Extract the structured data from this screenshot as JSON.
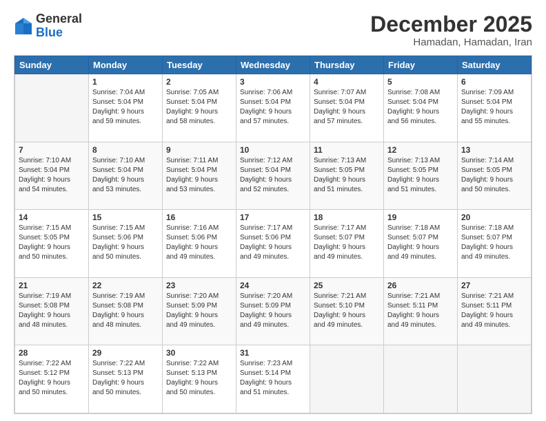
{
  "logo": {
    "general": "General",
    "blue": "Blue"
  },
  "header": {
    "month": "December 2025",
    "location": "Hamadan, Hamadan, Iran"
  },
  "weekdays": [
    "Sunday",
    "Monday",
    "Tuesday",
    "Wednesday",
    "Thursday",
    "Friday",
    "Saturday"
  ],
  "weeks": [
    [
      {
        "day": "",
        "info": ""
      },
      {
        "day": "1",
        "info": "Sunrise: 7:04 AM\nSunset: 5:04 PM\nDaylight: 9 hours\nand 59 minutes."
      },
      {
        "day": "2",
        "info": "Sunrise: 7:05 AM\nSunset: 5:04 PM\nDaylight: 9 hours\nand 58 minutes."
      },
      {
        "day": "3",
        "info": "Sunrise: 7:06 AM\nSunset: 5:04 PM\nDaylight: 9 hours\nand 57 minutes."
      },
      {
        "day": "4",
        "info": "Sunrise: 7:07 AM\nSunset: 5:04 PM\nDaylight: 9 hours\nand 57 minutes."
      },
      {
        "day": "5",
        "info": "Sunrise: 7:08 AM\nSunset: 5:04 PM\nDaylight: 9 hours\nand 56 minutes."
      },
      {
        "day": "6",
        "info": "Sunrise: 7:09 AM\nSunset: 5:04 PM\nDaylight: 9 hours\nand 55 minutes."
      }
    ],
    [
      {
        "day": "7",
        "info": "Sunrise: 7:10 AM\nSunset: 5:04 PM\nDaylight: 9 hours\nand 54 minutes."
      },
      {
        "day": "8",
        "info": "Sunrise: 7:10 AM\nSunset: 5:04 PM\nDaylight: 9 hours\nand 53 minutes."
      },
      {
        "day": "9",
        "info": "Sunrise: 7:11 AM\nSunset: 5:04 PM\nDaylight: 9 hours\nand 53 minutes."
      },
      {
        "day": "10",
        "info": "Sunrise: 7:12 AM\nSunset: 5:04 PM\nDaylight: 9 hours\nand 52 minutes."
      },
      {
        "day": "11",
        "info": "Sunrise: 7:13 AM\nSunset: 5:05 PM\nDaylight: 9 hours\nand 51 minutes."
      },
      {
        "day": "12",
        "info": "Sunrise: 7:13 AM\nSunset: 5:05 PM\nDaylight: 9 hours\nand 51 minutes."
      },
      {
        "day": "13",
        "info": "Sunrise: 7:14 AM\nSunset: 5:05 PM\nDaylight: 9 hours\nand 50 minutes."
      }
    ],
    [
      {
        "day": "14",
        "info": "Sunrise: 7:15 AM\nSunset: 5:05 PM\nDaylight: 9 hours\nand 50 minutes."
      },
      {
        "day": "15",
        "info": "Sunrise: 7:15 AM\nSunset: 5:06 PM\nDaylight: 9 hours\nand 50 minutes."
      },
      {
        "day": "16",
        "info": "Sunrise: 7:16 AM\nSunset: 5:06 PM\nDaylight: 9 hours\nand 49 minutes."
      },
      {
        "day": "17",
        "info": "Sunrise: 7:17 AM\nSunset: 5:06 PM\nDaylight: 9 hours\nand 49 minutes."
      },
      {
        "day": "18",
        "info": "Sunrise: 7:17 AM\nSunset: 5:07 PM\nDaylight: 9 hours\nand 49 minutes."
      },
      {
        "day": "19",
        "info": "Sunrise: 7:18 AM\nSunset: 5:07 PM\nDaylight: 9 hours\nand 49 minutes."
      },
      {
        "day": "20",
        "info": "Sunrise: 7:18 AM\nSunset: 5:07 PM\nDaylight: 9 hours\nand 49 minutes."
      }
    ],
    [
      {
        "day": "21",
        "info": "Sunrise: 7:19 AM\nSunset: 5:08 PM\nDaylight: 9 hours\nand 48 minutes."
      },
      {
        "day": "22",
        "info": "Sunrise: 7:19 AM\nSunset: 5:08 PM\nDaylight: 9 hours\nand 48 minutes."
      },
      {
        "day": "23",
        "info": "Sunrise: 7:20 AM\nSunset: 5:09 PM\nDaylight: 9 hours\nand 49 minutes."
      },
      {
        "day": "24",
        "info": "Sunrise: 7:20 AM\nSunset: 5:09 PM\nDaylight: 9 hours\nand 49 minutes."
      },
      {
        "day": "25",
        "info": "Sunrise: 7:21 AM\nSunset: 5:10 PM\nDaylight: 9 hours\nand 49 minutes."
      },
      {
        "day": "26",
        "info": "Sunrise: 7:21 AM\nSunset: 5:11 PM\nDaylight: 9 hours\nand 49 minutes."
      },
      {
        "day": "27",
        "info": "Sunrise: 7:21 AM\nSunset: 5:11 PM\nDaylight: 9 hours\nand 49 minutes."
      }
    ],
    [
      {
        "day": "28",
        "info": "Sunrise: 7:22 AM\nSunset: 5:12 PM\nDaylight: 9 hours\nand 50 minutes."
      },
      {
        "day": "29",
        "info": "Sunrise: 7:22 AM\nSunset: 5:13 PM\nDaylight: 9 hours\nand 50 minutes."
      },
      {
        "day": "30",
        "info": "Sunrise: 7:22 AM\nSunset: 5:13 PM\nDaylight: 9 hours\nand 50 minutes."
      },
      {
        "day": "31",
        "info": "Sunrise: 7:23 AM\nSunset: 5:14 PM\nDaylight: 9 hours\nand 51 minutes."
      },
      {
        "day": "",
        "info": ""
      },
      {
        "day": "",
        "info": ""
      },
      {
        "day": "",
        "info": ""
      }
    ]
  ]
}
